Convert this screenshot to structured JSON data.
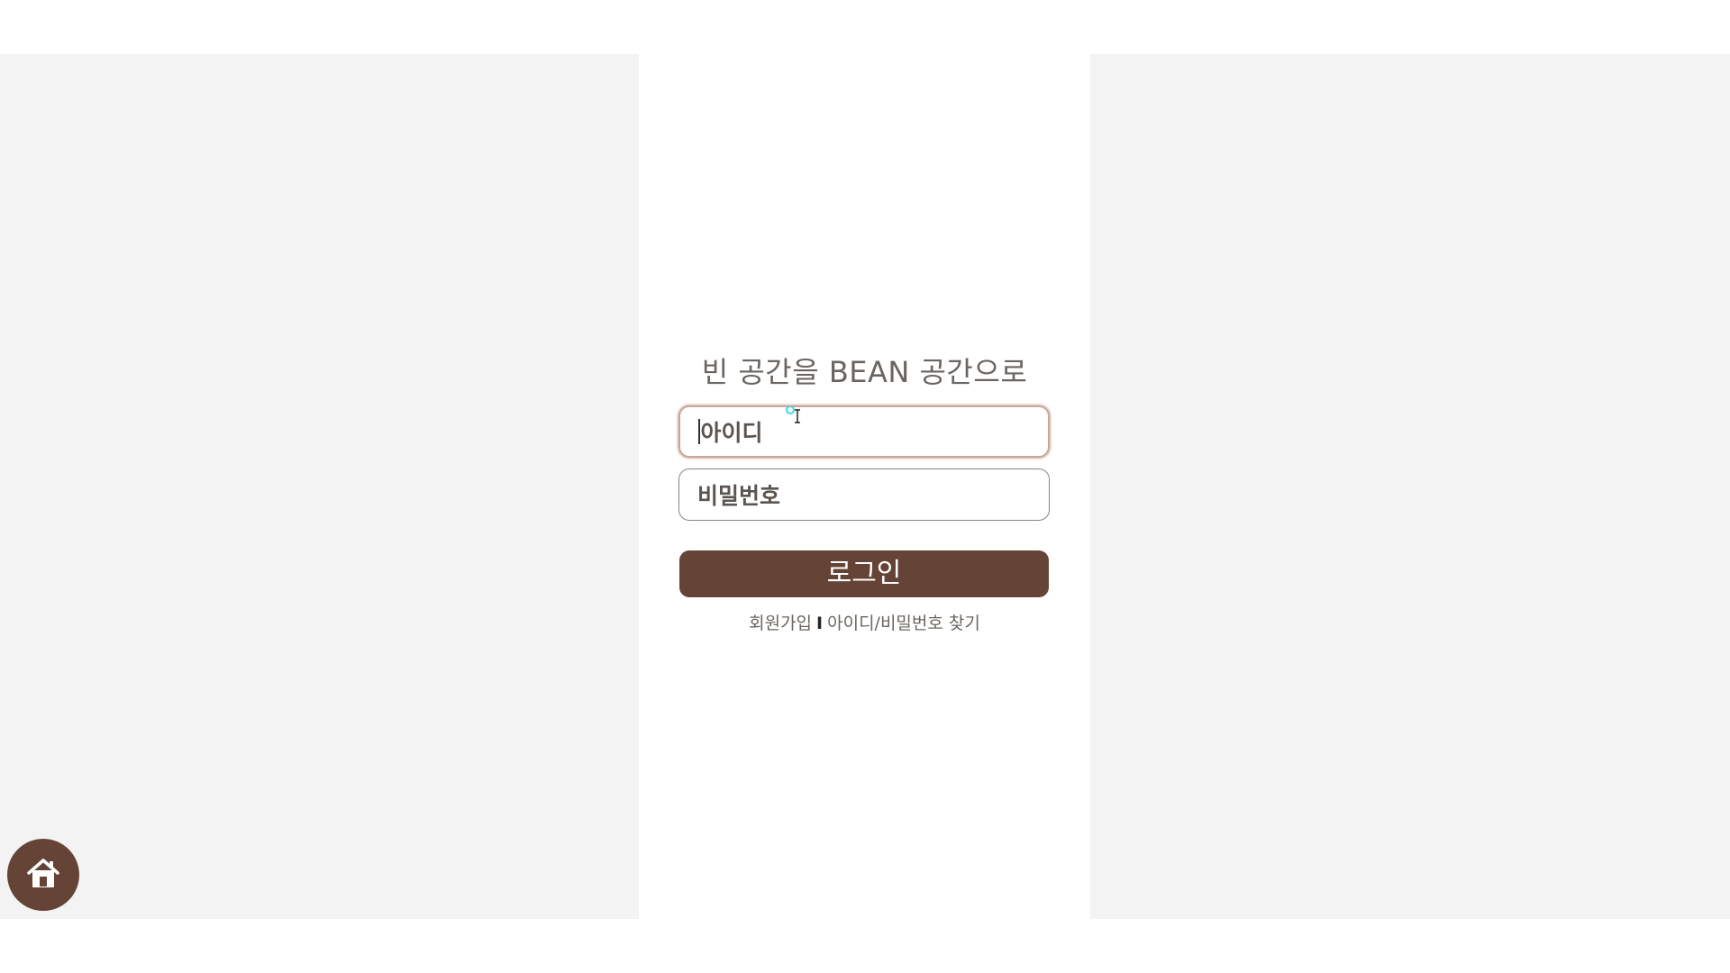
{
  "tagline": "빈 공간을 BEAN 공간으로",
  "login_form": {
    "id_placeholder": "아이디",
    "password_placeholder": "비밀번호",
    "login_label": "로그인"
  },
  "links": {
    "signup": "회원가입",
    "separator": "I",
    "find_account": "아이디/비밀번호 찾기"
  },
  "colors": {
    "brand_brown": "#654437",
    "side_background": "#f3f3f3",
    "focus_border": "#c9a79a"
  },
  "icons": {
    "home": "home-icon"
  }
}
